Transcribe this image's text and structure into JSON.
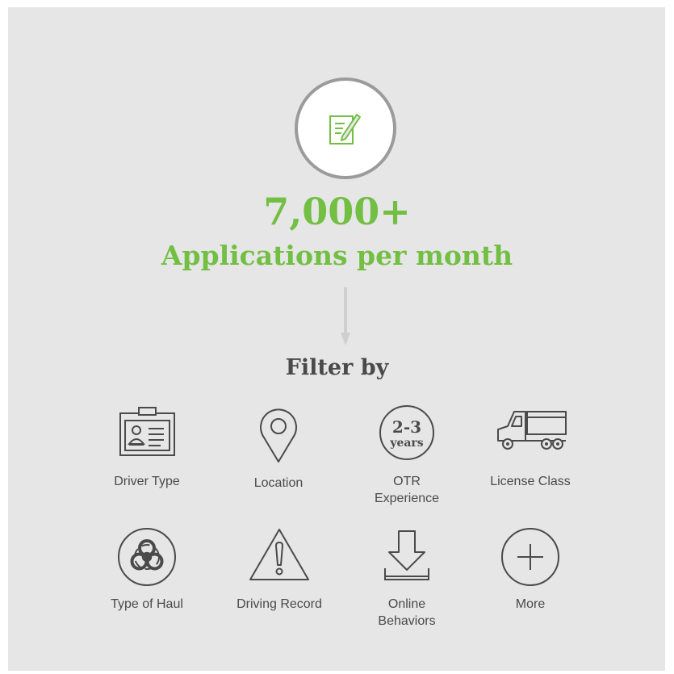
{
  "headline": {
    "count": "7,000+",
    "caption": "Applications per month",
    "icon": "edit-form-icon",
    "accent_color": "#72bf44"
  },
  "filter": {
    "title": "Filter by",
    "items": [
      {
        "label": "Driver Type",
        "icon": "id-badge-icon"
      },
      {
        "label": "Location",
        "icon": "location-pin-icon"
      },
      {
        "label": "OTR\nExperience",
        "icon": "years-badge-icon",
        "badge_top": "2-3",
        "badge_bottom": "years"
      },
      {
        "label": "License Class",
        "icon": "truck-icon"
      },
      {
        "label": "Type of Haul",
        "icon": "biohazard-icon"
      },
      {
        "label": "Driving Record",
        "icon": "warning-icon"
      },
      {
        "label": "Online\nBehaviors",
        "icon": "download-tray-icon"
      },
      {
        "label": "More",
        "icon": "plus-circle-icon"
      }
    ]
  }
}
